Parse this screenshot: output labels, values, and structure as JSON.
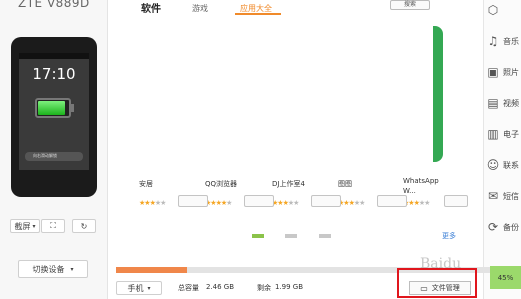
{
  "device": {
    "name": "ZTE V889D",
    "screen": {
      "date": "",
      "time": "17:10",
      "unlock_hint": "向右滑动解锁",
      "battery_level": 0.9
    }
  },
  "left_toolbar": {
    "screenshot_label": "截屏",
    "switch_device_label": "切换设备"
  },
  "tabs": [
    {
      "label": "软件",
      "active": true
    },
    {
      "label": "游戏",
      "active": false
    },
    {
      "label": "应用大全",
      "active": false
    }
  ],
  "search_button": "搜索",
  "apps": [
    {
      "name": "安居",
      "rating": 3,
      "icon_color": "#e84b3a"
    },
    {
      "name": "QQ浏览器",
      "rating": 4,
      "icon_color": "#f08a2a"
    },
    {
      "name": "DJ上作室4",
      "rating": 3,
      "icon_color": "#1e1e1e"
    },
    {
      "name": "图图",
      "rating": 3,
      "icon_color": "#3a7bd5"
    },
    {
      "name": "WhatsApp W...",
      "rating": 3,
      "icon_color": "#34a853"
    }
  ],
  "more_link": "更多",
  "pager": {
    "count": 3,
    "active": 0
  },
  "sidebar": {
    "items": [
      {
        "label": "",
        "icon": "cube-icon"
      },
      {
        "label": "音乐",
        "icon": "music-icon"
      },
      {
        "label": "照片",
        "icon": "photo-icon"
      },
      {
        "label": "视频",
        "icon": "video-icon"
      },
      {
        "label": "电子",
        "icon": "book-icon"
      },
      {
        "label": "联系",
        "icon": "contact-icon"
      },
      {
        "label": "短信",
        "icon": "sms-icon"
      },
      {
        "label": "备份",
        "icon": "backup-icon"
      }
    ]
  },
  "storage": {
    "location": "手机",
    "total_label": "总容量",
    "total": "2.46 GB",
    "free_label": "剩余",
    "free": "1.99 GB",
    "used_fraction": 0.19
  },
  "file_manager_label": "文件管理",
  "percent": "45%",
  "watermark": "Baidu"
}
